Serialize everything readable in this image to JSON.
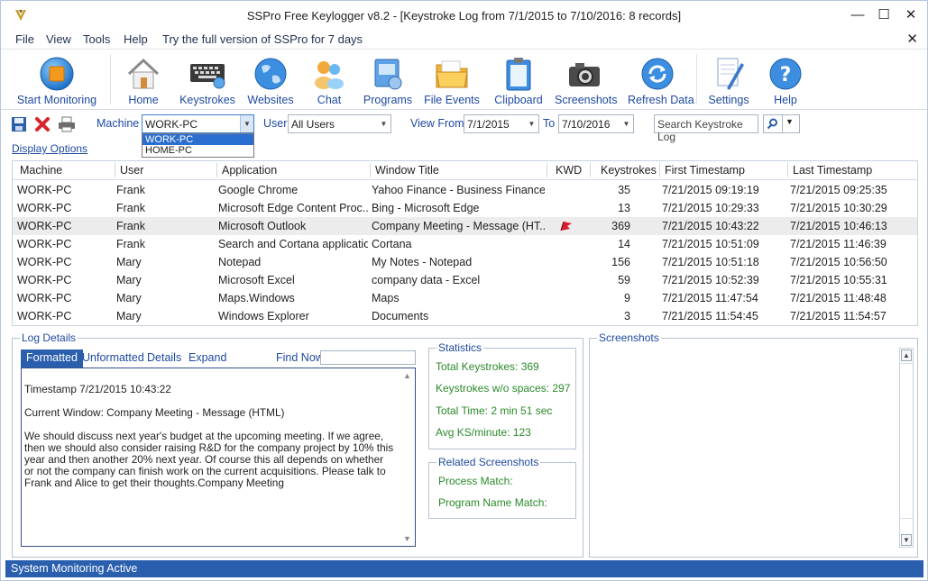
{
  "window": {
    "title": "SSPro Free Keylogger v8.2 - [Keystroke Log from 7/1/2015 to 7/10/2016: 8 records]",
    "minimize": "—",
    "maximize": "☐",
    "close": "✕"
  },
  "menu": {
    "items": [
      "File",
      "View",
      "Tools",
      "Help",
      "Try the full version of SSPro for 7 days"
    ],
    "close": "✕"
  },
  "ribbon": {
    "buttons": [
      {
        "label": "Start Monitoring",
        "icon": "record-icon"
      },
      {
        "label": "Home",
        "icon": "home-icon"
      },
      {
        "label": "Keystrokes",
        "icon": "keyboard-icon"
      },
      {
        "label": "Websites",
        "icon": "globe-icon"
      },
      {
        "label": "Chat",
        "icon": "chat-icon"
      },
      {
        "label": "Programs",
        "icon": "programs-icon"
      },
      {
        "label": "File Events",
        "icon": "folder-icon"
      },
      {
        "label": "Clipboard",
        "icon": "clipboard-icon"
      },
      {
        "label": "Screenshots",
        "icon": "camera-icon"
      },
      {
        "label": "Refresh Data",
        "icon": "refresh-icon"
      },
      {
        "label": "Settings",
        "icon": "settings-icon"
      },
      {
        "label": "Help",
        "icon": "help-icon"
      }
    ]
  },
  "filters": {
    "machine_label": "Machine",
    "machine_value": "WORK-PC",
    "machine_options": [
      "WORK-PC",
      "HOME-PC"
    ],
    "user_label": "User",
    "user_value": "All Users",
    "view_from_label": "View From",
    "view_from_value": "7/1/2015",
    "to_label": "To",
    "to_value": "7/10/2016",
    "search_placeholder": "Search Keystroke Log"
  },
  "display_options": "Display Options",
  "table": {
    "columns": [
      "Machine",
      "User",
      "Application",
      "Window Title",
      "KWD",
      "Keystrokes",
      "First Timestamp",
      "Last Timestamp"
    ],
    "rows": [
      {
        "machine": "WORK-PC",
        "user": "Frank",
        "application": "Google Chrome",
        "window_title": "Yahoo Finance - Business Finance...",
        "kwd": "",
        "keystrokes": "35",
        "first": "7/21/2015 09:19:19",
        "last": "7/21/2015 09:25:35"
      },
      {
        "machine": "WORK-PC",
        "user": "Frank",
        "application": "Microsoft Edge Content Proc...",
        "window_title": "Bing - Microsoft Edge",
        "kwd": "",
        "keystrokes": "13",
        "first": "7/21/2015 10:29:33",
        "last": "7/21/2015 10:30:29"
      },
      {
        "machine": "WORK-PC",
        "user": "Frank",
        "application": "Microsoft Outlook",
        "window_title": "Company Meeting - Message (HT...",
        "kwd": "flag",
        "keystrokes": "369",
        "first": "7/21/2015 10:43:22",
        "last": "7/21/2015 10:46:13"
      },
      {
        "machine": "WORK-PC",
        "user": "Frank",
        "application": "Search and Cortana application",
        "window_title": "Cortana",
        "kwd": "",
        "keystrokes": "14",
        "first": "7/21/2015 10:51:09",
        "last": "7/21/2015 11:46:39"
      },
      {
        "machine": "WORK-PC",
        "user": "Mary",
        "application": "Notepad",
        "window_title": "My Notes - Notepad",
        "kwd": "",
        "keystrokes": "156",
        "first": "7/21/2015 10:51:18",
        "last": "7/21/2015 10:56:50"
      },
      {
        "machine": "WORK-PC",
        "user": "Mary",
        "application": "Microsoft Excel",
        "window_title": "company data - Excel",
        "kwd": "",
        "keystrokes": "59",
        "first": "7/21/2015 10:52:39",
        "last": "7/21/2015 10:55:31"
      },
      {
        "machine": "WORK-PC",
        "user": "Mary",
        "application": "Maps.Windows",
        "window_title": "Maps",
        "kwd": "",
        "keystrokes": "9",
        "first": "7/21/2015 11:47:54",
        "last": "7/21/2015 11:48:48"
      },
      {
        "machine": "WORK-PC",
        "user": "Mary",
        "application": "Windows Explorer",
        "window_title": "Documents",
        "kwd": "",
        "keystrokes": "3",
        "first": "7/21/2015 11:54:45",
        "last": "7/21/2015 11:54:57"
      }
    ],
    "highlight_color": "#ececec"
  },
  "log_details": {
    "title": "Log Details",
    "tabs": [
      "Formatted",
      "Unformatted",
      "Details",
      "Expand"
    ],
    "find_now": "Find Now",
    "timestamp": "Timestamp 7/21/2015 10:43:22",
    "current_window": "Current Window: Company Meeting - Message (HTML)",
    "body": "We should discuss next year's budget at the upcoming meeting. If we agree, then we should also consider raising R&D for the company project by 10% this year and then another 20% next year. Of course this all depends on whether or not the company can finish work on the current acquisitions. Please talk to Frank and Alice to get their thoughts.Company Meeting"
  },
  "statistics": {
    "title": "Statistics",
    "total_keystrokes": "Total Keystrokes: 369",
    "without_spaces": "Keystrokes w/o spaces: 297",
    "total_time": "Total Time: 2 min 51 sec",
    "avg": "Avg KS/minute: 123"
  },
  "related": {
    "title": "Related Screenshots",
    "process_match": "Process Match:",
    "program_match": "Program Name Match:"
  },
  "screenshots": {
    "title": "Screenshots"
  },
  "status": {
    "text": "System Monitoring Active"
  },
  "colors": {
    "accent": "#2a5fae",
    "link": "#1f4aa0",
    "stat_green": "#2a8a2a"
  }
}
